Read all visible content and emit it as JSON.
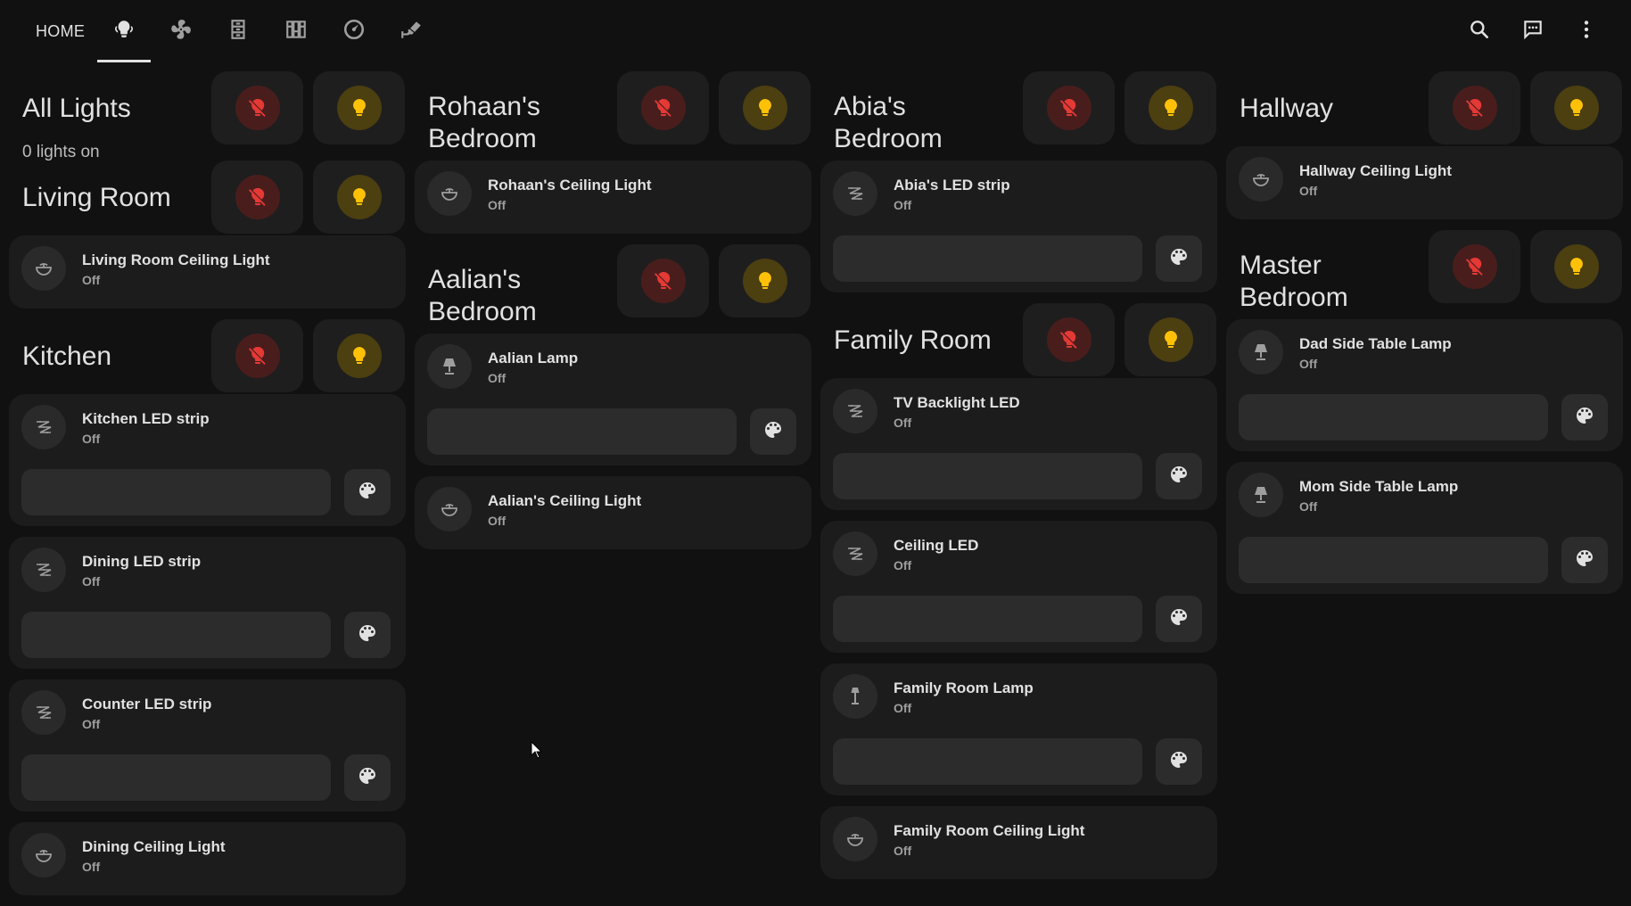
{
  "topbar": {
    "home_label": "HOME",
    "tabs": [
      "lightbulb-group-icon",
      "fan-icon",
      "dresser-icon",
      "bookshelf-icon",
      "gauge-icon",
      "cctv-icon"
    ],
    "active_tab": 1,
    "actions": [
      "search-icon",
      "assist-message-icon",
      "more-vertical-icon"
    ]
  },
  "colors": {
    "background": "#111111",
    "card": "#1c1c1c",
    "off_accent": "#e53935",
    "on_accent": "#ffc107"
  },
  "columns": [
    {
      "sections": [
        {
          "title": "All Lights",
          "subtitle": "0 lights on",
          "cards": []
        },
        {
          "title": "Living Room",
          "cards": [
            {
              "name": "Living Room Ceiling Light",
              "state": "Off",
              "icon": "ceiling-light-icon",
              "type": "simple"
            }
          ]
        },
        {
          "title": "Kitchen",
          "cards": [
            {
              "name": "Kitchen LED strip",
              "state": "Off",
              "icon": "led-strip-icon",
              "type": "strip"
            },
            {
              "name": "Dining LED strip",
              "state": "Off",
              "icon": "led-strip-icon",
              "type": "strip"
            },
            {
              "name": "Counter LED strip",
              "state": "Off",
              "icon": "led-strip-icon",
              "type": "strip"
            },
            {
              "name": "Dining Ceiling Light",
              "state": "Off",
              "icon": "ceiling-light-icon",
              "type": "simple"
            }
          ]
        }
      ]
    },
    {
      "sections": [
        {
          "title": "Rohaan's Bedroom",
          "cards": [
            {
              "name": "Rohaan's Ceiling Light",
              "state": "Off",
              "icon": "ceiling-light-icon",
              "type": "simple"
            }
          ]
        },
        {
          "title": "Aalian's Bedroom",
          "cards": [
            {
              "name": "Aalian Lamp",
              "state": "Off",
              "icon": "table-lamp-icon",
              "type": "strip"
            },
            {
              "name": "Aalian's Ceiling Light",
              "state": "Off",
              "icon": "ceiling-light-icon",
              "type": "simple"
            }
          ]
        }
      ]
    },
    {
      "sections": [
        {
          "title": "Abia's Bedroom",
          "cards": [
            {
              "name": "Abia's LED strip",
              "state": "Off",
              "icon": "led-strip-icon",
              "type": "strip"
            }
          ]
        },
        {
          "title": "Family Room",
          "cards": [
            {
              "name": "TV Backlight LED",
              "state": "Off",
              "icon": "led-strip-icon",
              "type": "strip"
            },
            {
              "name": "Ceiling LED",
              "state": "Off",
              "icon": "led-strip-icon",
              "type": "strip"
            },
            {
              "name": "Family Room Lamp",
              "state": "Off",
              "icon": "floor-lamp-icon",
              "type": "strip"
            },
            {
              "name": "Family Room Ceiling Light",
              "state": "Off",
              "icon": "ceiling-light-icon",
              "type": "simple"
            }
          ]
        }
      ]
    },
    {
      "sections": [
        {
          "title": "Hallway",
          "cards": [
            {
              "name": "Hallway Ceiling Light",
              "state": "Off",
              "icon": "ceiling-light-icon",
              "type": "simple"
            }
          ]
        },
        {
          "title": "Master Bedroom",
          "cards": [
            {
              "name": "Dad Side Table Lamp",
              "state": "Off",
              "icon": "table-lamp-icon",
              "type": "strip"
            },
            {
              "name": "Mom Side Table Lamp",
              "state": "Off",
              "icon": "table-lamp-icon",
              "type": "strip"
            }
          ]
        }
      ]
    }
  ]
}
